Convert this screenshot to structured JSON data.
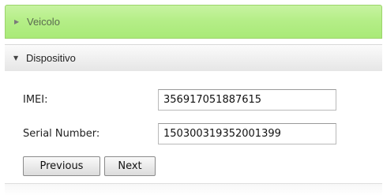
{
  "accordion": {
    "sections": [
      {
        "label": "Veicolo",
        "expanded": false,
        "icon": "triangle-right-icon"
      },
      {
        "label": "Dispositivo",
        "expanded": true,
        "icon": "triangle-down-icon"
      }
    ]
  },
  "form": {
    "imei": {
      "label": "IMEI:",
      "value": "356917051887615"
    },
    "serial": {
      "label": "Serial Number:",
      "value": "150300319352001399"
    }
  },
  "buttons": {
    "previous": "Previous",
    "next": "Next"
  },
  "icons": {
    "collapsed": "▶",
    "expanded": "▼"
  },
  "colors": {
    "active_header": "#b5ee88",
    "inactive_header": "#eeeeee"
  }
}
